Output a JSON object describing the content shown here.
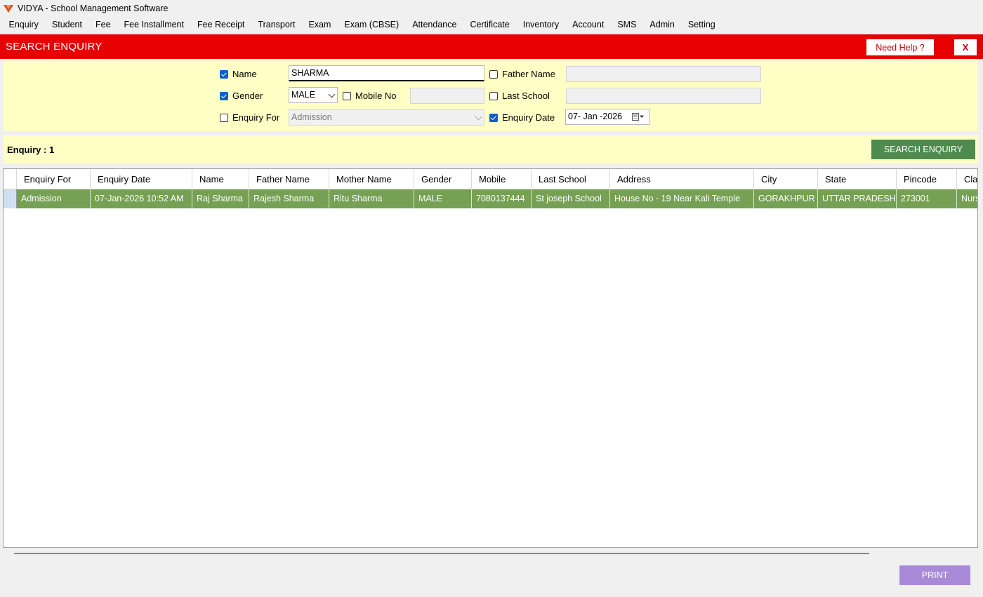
{
  "window": {
    "title": "VIDYA - School Management Software"
  },
  "menu": [
    "Enquiry",
    "Student",
    "Fee",
    "Fee Installment",
    "Fee Receipt",
    "Transport",
    "Exam",
    "Exam (CBSE)",
    "Attendance",
    "Certificate",
    "Inventory",
    "Account",
    "SMS",
    "Admin",
    "Setting"
  ],
  "header": {
    "title": "SEARCH ENQUIRY",
    "help_label": "Need Help ?",
    "close_label": "X"
  },
  "filters": {
    "name": {
      "label": "Name",
      "checked": true,
      "value": "SHARMA"
    },
    "father_name": {
      "label": "Father Name",
      "checked": false,
      "value": ""
    },
    "gender": {
      "label": "Gender",
      "checked": true,
      "value": "MALE"
    },
    "mobile_no": {
      "label": "Mobile No",
      "checked": false,
      "value": ""
    },
    "last_school": {
      "label": "Last School",
      "checked": false,
      "value": ""
    },
    "enquiry_for": {
      "label": "Enquiry For",
      "checked": false,
      "value": "Admission"
    },
    "enquiry_date": {
      "label": "Enquiry Date",
      "checked": true,
      "value": "07- Jan -2026"
    }
  },
  "summary": {
    "count_label": "Enquiry : 1",
    "search_label": "SEARCH ENQUIRY"
  },
  "table": {
    "columns": [
      "Enquiry For",
      "Enquiry Date",
      "Name",
      "Father Name",
      "Mother Name",
      "Gender",
      "Mobile",
      "Last School",
      "Address",
      "City",
      "State",
      "Pincode",
      "Class"
    ],
    "rows": [
      [
        "Admission",
        "07-Jan-2026 10:52 AM",
        "Raj Sharma",
        "Rajesh Sharma",
        "Ritu Sharma",
        "MALE",
        "7080137444",
        "St joseph School",
        "House No - 19 Near Kali Temple",
        "GORAKHPUR",
        "UTTAR PRADESH",
        "273001",
        "Nursery"
      ]
    ]
  },
  "footer": {
    "print_label": "PRINT"
  },
  "colors": {
    "header_red": "#e60000",
    "filter_bg": "#ffffc6",
    "row_green": "#76a054",
    "search_green": "#4f8a4f",
    "print_purple": "#a98ad8"
  }
}
